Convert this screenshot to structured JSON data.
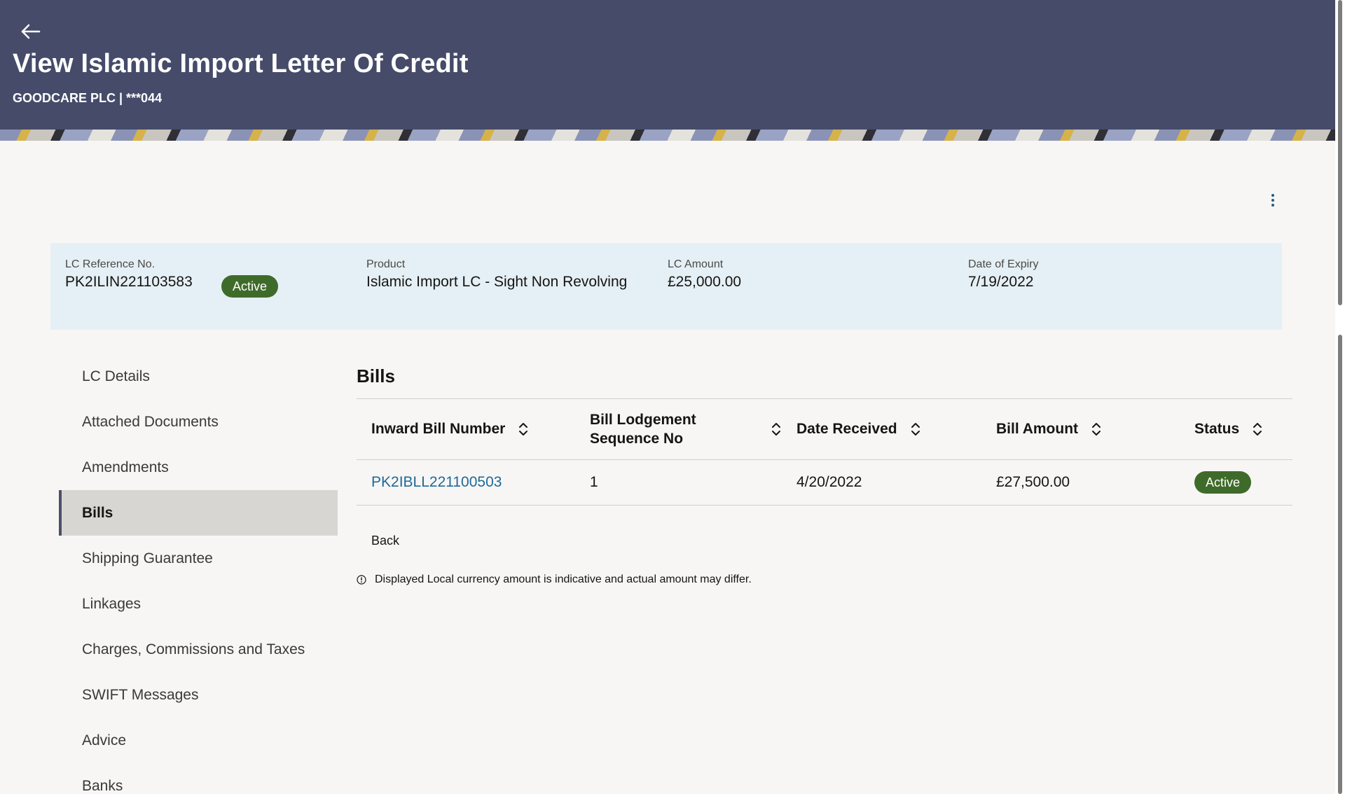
{
  "header": {
    "title": "View Islamic Import Letter Of Credit",
    "subtitle": "GOODCARE PLC | ***044"
  },
  "summary": {
    "reference": {
      "label": "LC Reference No.",
      "value": "PK2ILIN221103583",
      "status": "Active"
    },
    "product": {
      "label": "Product",
      "value": "Islamic Import LC - Sight Non Revolving"
    },
    "amount": {
      "label": "LC Amount",
      "value": "£25,000.00"
    },
    "expiry": {
      "label": "Date of Expiry",
      "value": "7/19/2022"
    }
  },
  "sidenav": {
    "items": [
      {
        "label": "LC Details"
      },
      {
        "label": "Attached Documents"
      },
      {
        "label": "Amendments"
      },
      {
        "label": "Bills"
      },
      {
        "label": "Shipping Guarantee"
      },
      {
        "label": "Linkages"
      },
      {
        "label": "Charges, Commissions and Taxes"
      },
      {
        "label": "SWIFT Messages"
      },
      {
        "label": "Advice"
      },
      {
        "label": "Banks"
      }
    ],
    "active": "Bills"
  },
  "bills": {
    "title": "Bills",
    "columns": [
      "Inward Bill Number",
      "Bill Lodgement Sequence No",
      "Date Received",
      "Bill Amount",
      "Status"
    ],
    "rows": [
      {
        "bill_number": "PK2IBLL221100503",
        "sequence": "1",
        "date_received": "4/20/2022",
        "amount": "£27,500.00",
        "status": "Active"
      }
    ],
    "back_label": "Back",
    "note": "Displayed Local currency amount is indicative and actual amount may differ."
  },
  "colors": {
    "header_bg": "#454b69",
    "summary_bg": "#e5f0f6",
    "badge_green": "#3f6b2a",
    "link_blue": "#1d6a99"
  },
  "icons": [
    "back-arrow-icon",
    "kebab-menu-icon",
    "sort-icon",
    "info-icon"
  ]
}
